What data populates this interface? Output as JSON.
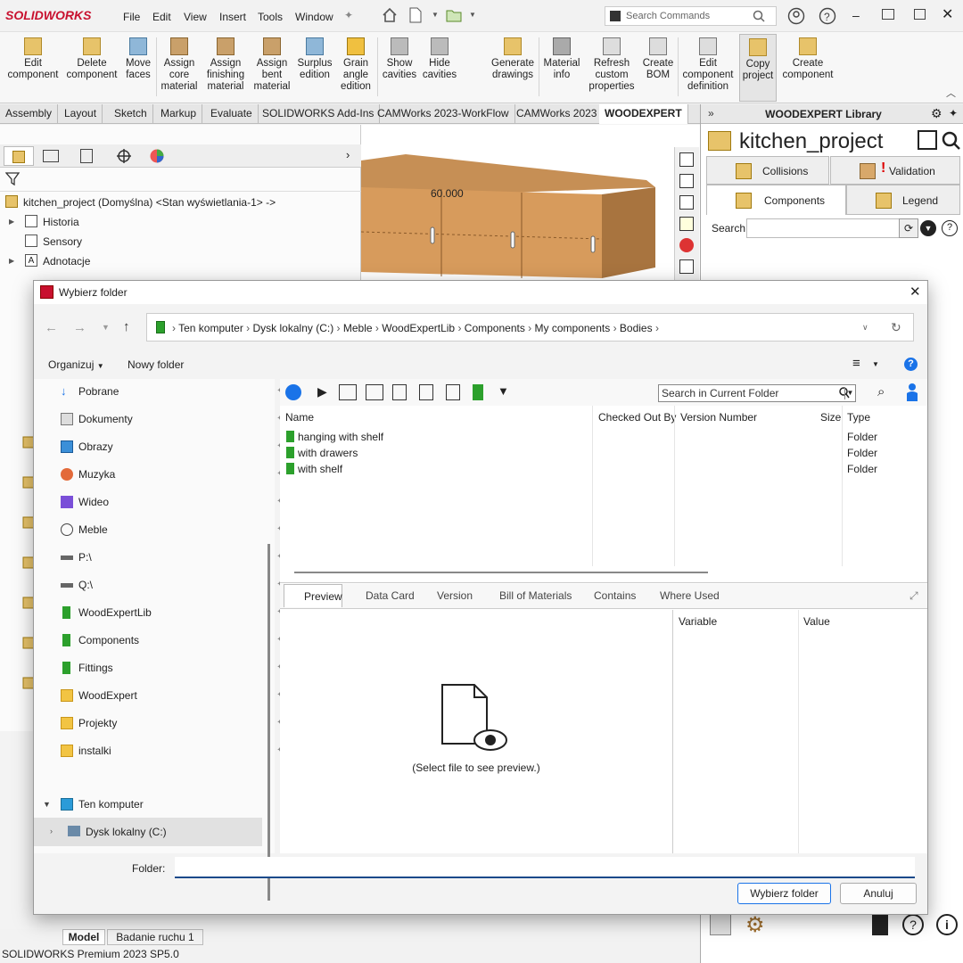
{
  "app": {
    "brand": "SOLIDWORKS",
    "menu": [
      "File",
      "Edit",
      "View",
      "Insert",
      "Tools",
      "Window"
    ],
    "search_placeholder": "Search Commands"
  },
  "ribbon": [
    {
      "label": "Edit\ncomponent"
    },
    {
      "label": "Delete\ncomponent"
    },
    {
      "label": "Move\nfaces"
    },
    {
      "label": "Assign\ncore\nmaterial"
    },
    {
      "label": "Assign\nfinishing\nmaterial"
    },
    {
      "label": "Assign\nbent\nmaterial"
    },
    {
      "label": "Surplus\nedition"
    },
    {
      "label": "Grain\nangle\nedition"
    },
    {
      "label": "Show\ncavities"
    },
    {
      "label": "Hide\ncavities"
    },
    {
      "label": "Generate\ndrawings"
    },
    {
      "label": "Material\ninfo"
    },
    {
      "label": "Refresh\ncustom\nproperties"
    },
    {
      "label": "Create\nBOM"
    },
    {
      "label": "Edit\ncomponent\ndefinition"
    },
    {
      "label": "Copy\nproject"
    },
    {
      "label": "Create\ncomponent"
    }
  ],
  "tabs": [
    "Assembly",
    "Layout",
    "Sketch",
    "Markup",
    "Evaluate",
    "SOLIDWORKS Add-Ins",
    "CAMWorks 2023-WorkFlow",
    "CAMWorks 2023",
    "WOODEXPERT"
  ],
  "active_tab": "WOODEXPERT",
  "tree": {
    "root": "kitchen_project (Domyślna) <Stan wyświetlania-1> ->",
    "items": [
      "Historia",
      "Sensory",
      "Adnotacje"
    ]
  },
  "viewport": {
    "dimension": "60.000"
  },
  "library": {
    "header": "WOODEXPERT Library",
    "project": "kitchen_project",
    "tabs": [
      "Collisions",
      "Validation",
      "Components",
      "Legend"
    ],
    "search_label": "Search"
  },
  "status": {
    "tabs": [
      "Model",
      "Badanie ruchu 1"
    ],
    "text": "SOLIDWORKS Premium 2023 SP5.0"
  },
  "dialog": {
    "title": "Wybierz folder",
    "breadcrumb": [
      "Ten komputer",
      "Dysk lokalny (C:)",
      "Meble",
      "WoodExpertLib",
      "Components",
      "My components",
      "Bodies"
    ],
    "organize": "Organizuj",
    "new_folder": "Nowy folder",
    "nav": [
      "Pobrane",
      "Dokumenty",
      "Obrazy",
      "Muzyka",
      "Wideo",
      "Meble",
      "P:\\",
      "Q:\\",
      "WoodExpertLib",
      "Components",
      "Fittings",
      "WoodExpert",
      "Projekty",
      "instalki"
    ],
    "tree_computer": "Ten komputer",
    "tree_disk": "Dysk lokalny (C:)",
    "search_placeholder": "Search in Current Folder",
    "columns": [
      "Name",
      "Checked Out By",
      "Version Number",
      "Size",
      "Type"
    ],
    "files": [
      {
        "name": "hanging with shelf",
        "type": "Folder"
      },
      {
        "name": "with drawers",
        "type": "Folder"
      },
      {
        "name": "with shelf",
        "type": "Folder"
      }
    ],
    "preview_tabs": [
      "Preview",
      "Data Card",
      "Version",
      "Bill of Materials",
      "Contains",
      "Where Used"
    ],
    "preview_text": "(Select file to see preview.)",
    "var_cols": [
      "Variable",
      "Value"
    ],
    "folder_label": "Folder:",
    "folder_value": "",
    "ok": "Wybierz folder",
    "cancel": "Anuluj"
  }
}
